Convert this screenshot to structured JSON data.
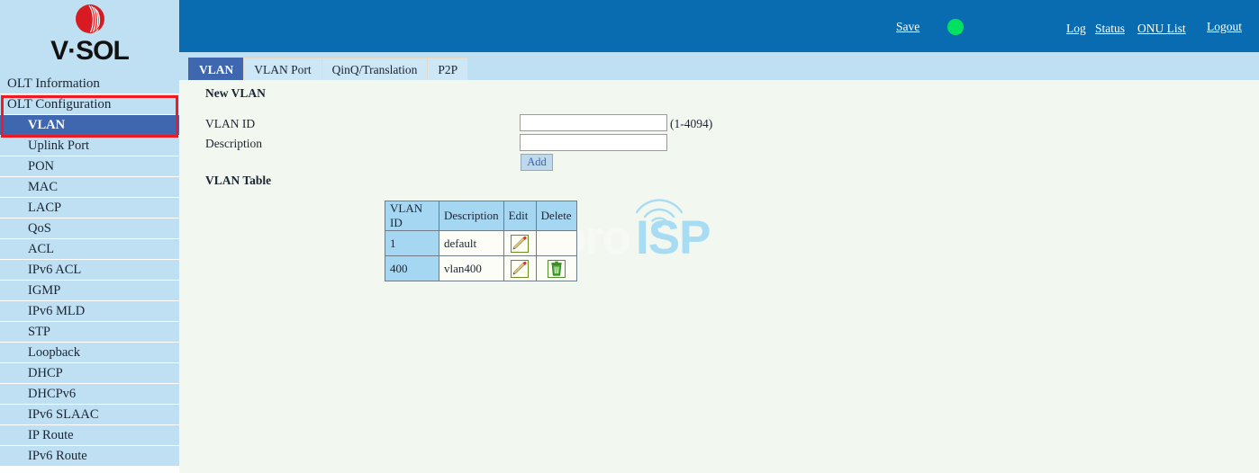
{
  "brand": {
    "logo_icon": "vsol-logo-icon",
    "wordmark": "V·SOL"
  },
  "sidebar": {
    "items": [
      {
        "label": "OLT Information",
        "level": 1,
        "active": false
      },
      {
        "label": "OLT Configuration",
        "level": 1,
        "active": false
      },
      {
        "label": "VLAN",
        "level": 2,
        "active": true
      },
      {
        "label": "Uplink Port",
        "level": 2,
        "active": false
      },
      {
        "label": "PON",
        "level": 2,
        "active": false
      },
      {
        "label": "MAC",
        "level": 2,
        "active": false
      },
      {
        "label": "LACP",
        "level": 2,
        "active": false
      },
      {
        "label": "QoS",
        "level": 2,
        "active": false
      },
      {
        "label": "ACL",
        "level": 2,
        "active": false
      },
      {
        "label": "IPv6 ACL",
        "level": 2,
        "active": false
      },
      {
        "label": "IGMP",
        "level": 2,
        "active": false
      },
      {
        "label": "IPv6 MLD",
        "level": 2,
        "active": false
      },
      {
        "label": "STP",
        "level": 2,
        "active": false
      },
      {
        "label": "Loopback",
        "level": 2,
        "active": false
      },
      {
        "label": "DHCP",
        "level": 2,
        "active": false
      },
      {
        "label": "DHCPv6",
        "level": 2,
        "active": false
      },
      {
        "label": "IPv6 SLAAC",
        "level": 2,
        "active": false
      },
      {
        "label": "IP Route",
        "level": 2,
        "active": false
      },
      {
        "label": "IPv6 Route",
        "level": 2,
        "active": false
      }
    ],
    "highlight_color": "#ED1C24"
  },
  "header": {
    "background": "#0A6CB0",
    "save_label": "Save",
    "status_indicator": {
      "icon": "green-status-dot-icon",
      "color": "#00E25F"
    },
    "links": [
      {
        "label": "Log"
      },
      {
        "label": "Status"
      },
      {
        "label": "ONU List"
      },
      {
        "label": "Logout"
      }
    ]
  },
  "tabs": [
    {
      "label": "VLAN",
      "active": true
    },
    {
      "label": "VLAN Port",
      "active": false
    },
    {
      "label": "QinQ/Translation",
      "active": false
    },
    {
      "label": "P2P",
      "active": false
    }
  ],
  "main": {
    "new_vlan": {
      "title": "New VLAN",
      "vlan_id_label": "VLAN ID",
      "vlan_id_value": "",
      "vlan_id_hint": "(1-4094)",
      "description_label": "Description",
      "description_value": "",
      "add_label": "Add"
    },
    "vlan_table": {
      "title": "VLAN Table",
      "columns": [
        "VLAN ID",
        "Description",
        "Edit",
        "Delete"
      ],
      "rows": [
        {
          "vlan_id": "1",
          "description": "default",
          "edit_icon": "edit-pencil-icon",
          "delete_icon": null
        },
        {
          "vlan_id": "400",
          "description": "vlan400",
          "edit_icon": "edit-pencil-icon",
          "delete_icon": "delete-trash-icon"
        }
      ]
    }
  },
  "watermark": {
    "text_light": "Foro",
    "text_accent": "ISP",
    "accent_color": "#A8DCF2",
    "signal_icon": "wifi-antenna-icon"
  }
}
